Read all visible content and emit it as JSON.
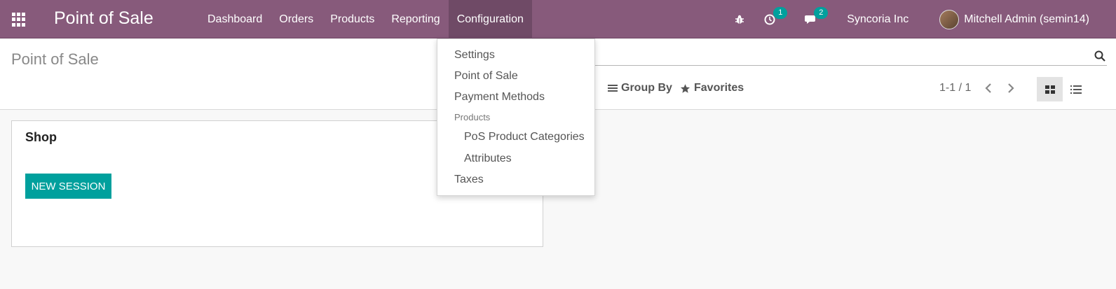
{
  "navbar": {
    "brand": "Point of Sale",
    "menu": [
      {
        "label": "Dashboard",
        "active": false
      },
      {
        "label": "Orders",
        "active": false
      },
      {
        "label": "Products",
        "active": false
      },
      {
        "label": "Reporting",
        "active": false
      },
      {
        "label": "Configuration",
        "active": true
      }
    ],
    "systray": {
      "debug_icon": "bug-icon",
      "activity_count": "1",
      "messages_count": "2",
      "company": "Syncoria Inc",
      "user": "Mitchell Admin (semin14)"
    }
  },
  "control_panel": {
    "breadcrumb": "Point of Sale",
    "search_placeholder": "",
    "group_by_label": "Group By",
    "favorites_label": "Favorites",
    "pager": "1-1 / 1"
  },
  "card": {
    "title": "Shop",
    "button_label": "NEW SESSION"
  },
  "dropdown": {
    "items": [
      {
        "label": "Settings"
      },
      {
        "label": "Point of Sale"
      },
      {
        "label": "Payment Methods"
      }
    ],
    "section_header": "Products",
    "sub_items": [
      {
        "label": "PoS Product Categories"
      },
      {
        "label": "Attributes"
      }
    ],
    "last_item": {
      "label": "Taxes"
    }
  },
  "colors": {
    "navbar_bg": "#875a7b",
    "navbar_active": "#6f4a66",
    "primary_button": "#00a09d",
    "badge": "#00a09d"
  }
}
